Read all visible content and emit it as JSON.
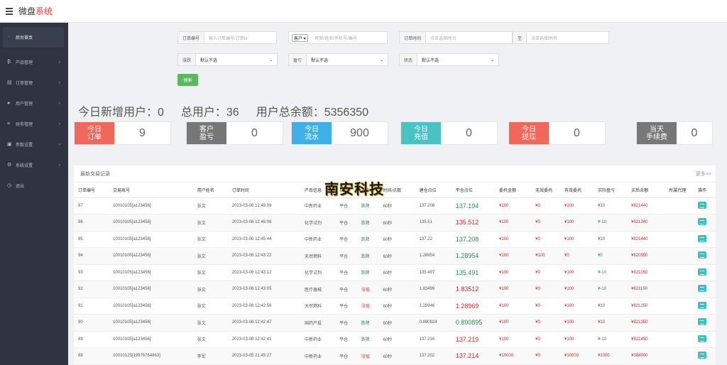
{
  "app": {
    "title_main": "微盘",
    "title_accent": "系统"
  },
  "sidebar": {
    "items": [
      {
        "label": "后台首页",
        "icon": "dashboard-icon",
        "active": true
      },
      {
        "label": "产品管理",
        "icon": "product-icon"
      },
      {
        "label": "订单管理",
        "icon": "order-icon"
      },
      {
        "label": "用户管理",
        "icon": "user-icon"
      },
      {
        "label": "财务管理",
        "icon": "finance-icon"
      },
      {
        "label": "参数设置",
        "icon": "params-icon"
      },
      {
        "label": "系统设置",
        "icon": "settings-icon"
      },
      {
        "label": "退出",
        "icon": "logout-icon"
      }
    ]
  },
  "filters": {
    "order_no_label": "订单编号",
    "order_no_placeholder": "输入订单编号/订单id",
    "client_select": "客户",
    "client_placeholder": "昵称/姓名/手机号/编号",
    "order_time_label": "订单时间",
    "time_placeholder": "点击选择时间",
    "to_label": "至",
    "updown_label": "涨跌",
    "profit_label": "盈亏",
    "status_label": "状态",
    "default_option": "默认不选",
    "search_button": "搜索"
  },
  "stats": {
    "new_users": "今日新增用户：0",
    "total_users": "总用户：36",
    "total_balance": "用户总余额：5356350"
  },
  "kpis": [
    {
      "tag": "今日\n订单",
      "value": "9",
      "color": "#f0675c"
    },
    {
      "tag": "客户\n盈亏",
      "value": "0",
      "color": "#777777"
    },
    {
      "tag": "今日\n流水",
      "value": "900",
      "color": "#3fb0e6"
    },
    {
      "tag": "今日\n充值",
      "value": "0",
      "color": "#48c2c2"
    },
    {
      "tag": "今日\n提现",
      "value": "0",
      "color": "#f0675c"
    },
    {
      "tag": "当天\n手续费",
      "value": "0",
      "color": "#777777"
    }
  ],
  "panel": {
    "title": "最新交易记录",
    "more": "更多>>",
    "logo_text": "南安科技"
  },
  "table": {
    "headers": [
      "订单编号",
      "交易账号",
      "用户姓名",
      "订单时间",
      "产品信息",
      "状态",
      "方向",
      "时间/点数",
      "建仓点位",
      "平仓点位",
      "委托金额",
      "无效委托",
      "有效委托",
      "实际盈亏",
      "买后余额",
      "所属代理",
      "操作"
    ],
    "rows": [
      [
        "97",
        "10010105[a123456]",
        "张文",
        "2023-03-06 12:48:09",
        "中新药业",
        "平仓",
        "跌降",
        "60秒",
        "137.208",
        "137.194",
        "¥100",
        "¥0",
        "¥100",
        "¥10",
        "¥821440",
        ""
      ],
      [
        "96",
        "10010105[a123456]",
        "张文",
        "2023-03-06 12:46:06",
        "化学试剂",
        "平仓",
        "跌降",
        "60秒",
        "135.51",
        "135.512",
        "¥100",
        "¥0",
        "¥100",
        "¥-10",
        "¥821340",
        ""
      ],
      [
        "95",
        "10010105[a123456]",
        "张文",
        "2023-03-06 12:45:44",
        "中新药业",
        "平仓",
        "跌降",
        "60秒",
        "137.22",
        "137.208",
        "¥100",
        "¥0",
        "¥100",
        "¥10",
        "¥821440",
        ""
      ],
      [
        "94",
        "10010105[a123456]",
        "张文",
        "2023-03-06 12:43:22",
        "天然燃料",
        "平仓",
        "跌降",
        "60秒",
        "1.28954",
        "1.28954",
        "¥100",
        "¥100",
        "¥0",
        "¥0",
        "¥820950",
        ""
      ],
      [
        "93",
        "10010105[a123456]",
        "张文",
        "2023-03-06 12:43:12",
        "化学试剂",
        "平仓",
        "跌降",
        "60秒",
        "135.497",
        "135.491",
        "¥100",
        "¥0",
        "¥100",
        "¥-10",
        "¥821050",
        ""
      ],
      [
        "92",
        "10010105[a123456]",
        "张文",
        "2023-03-06 12:43:05",
        "医疗器械",
        "平仓",
        "涨幅",
        "60秒",
        "1.83499",
        "1.83512",
        "¥100",
        "¥0",
        "¥100",
        "¥-10",
        "¥821150",
        ""
      ],
      [
        "91",
        "10010105[a123456]",
        "张文",
        "2023-03-06 12:42:56",
        "天然燃料",
        "平仓",
        "涨幅",
        "60秒",
        "1.28946",
        "1.28969",
        "¥100",
        "¥0",
        "¥100",
        "¥10",
        "¥821250",
        ""
      ],
      [
        "90",
        "10010105[a123456]",
        "张文",
        "2023-03-06 12:42:47",
        "国药产投",
        "平仓",
        "跌降",
        "60秒",
        "0.890924",
        "0.890895",
        "¥100",
        "¥0",
        "¥100",
        "¥10",
        "¥821350",
        ""
      ],
      [
        "89",
        "10010105[a123456]",
        "张文",
        "2023-03-06 12:42:41",
        "中新药业",
        "平仓",
        "跌降",
        "60秒",
        "137.216",
        "137.219",
        "¥100",
        "¥0",
        "¥100",
        "¥-10",
        "¥821450",
        ""
      ],
      [
        "88",
        "10010125[19976764863]",
        "李军",
        "2023-03-05 21:45:27",
        "中新药业",
        "平仓",
        "涨幅",
        "60秒",
        "137.202",
        "137.214",
        "¥10000",
        "¥0",
        "¥10000",
        "¥1000",
        "¥384900",
        ""
      ]
    ]
  }
}
